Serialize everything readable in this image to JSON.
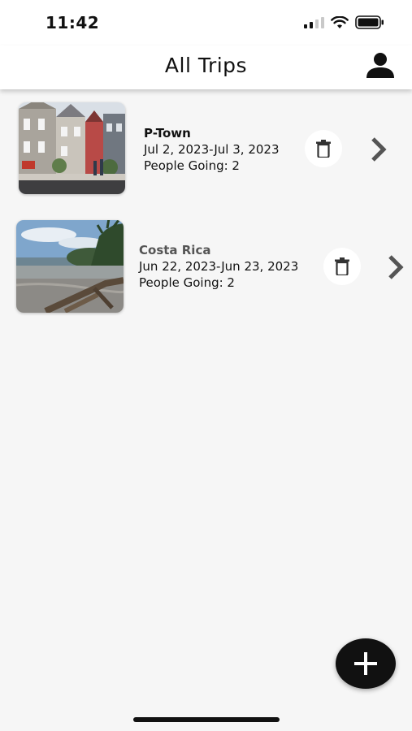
{
  "status_bar": {
    "time": "11:42"
  },
  "header": {
    "title": "All Trips",
    "profile_icon": "person-icon"
  },
  "trips": [
    {
      "name": "P-Town",
      "dates": "Jul 2, 2023-Jul 3, 2023",
      "people": "People Going: 2"
    },
    {
      "name": "Costa Rica",
      "dates": "Jun 22, 2023-Jun 23, 2023",
      "people": "People Going: 2"
    }
  ],
  "actions": {
    "add_icon": "plus-icon",
    "delete_icon": "trash-icon",
    "open_icon": "chevron-right-icon"
  },
  "colors": {
    "background": "#f6f6f6",
    "surface": "#ffffff",
    "fab": "#111111",
    "chevron": "#555555"
  }
}
